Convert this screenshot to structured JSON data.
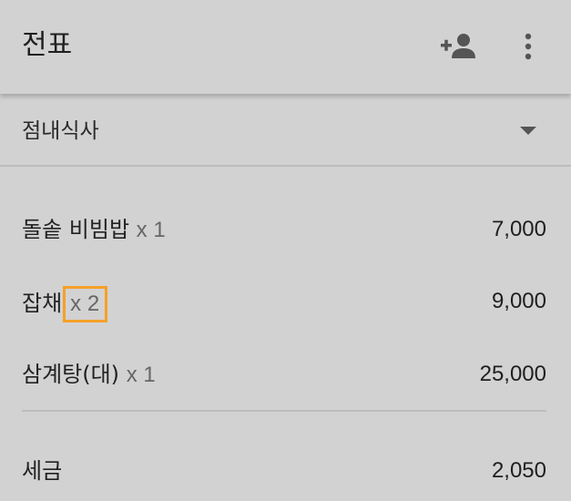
{
  "appbar": {
    "title": "전표",
    "actions": [
      {
        "icon": "person-add-icon"
      },
      {
        "icon": "more-vert-icon"
      }
    ]
  },
  "dropdown": {
    "selected": "점내식사"
  },
  "items": [
    {
      "name": "돌솥 비빔밥",
      "qty": "x 1",
      "price": "7,000"
    },
    {
      "name": "잡채",
      "qty": "x 2",
      "price": "9,000"
    },
    {
      "name": "삼계탕(대)",
      "qty": "x 1",
      "price": "25,000"
    }
  ],
  "tax": {
    "label": "세금",
    "amount": "2,050"
  },
  "colors": {
    "background": "#d2d2d2",
    "highlight": "#f5a028"
  }
}
